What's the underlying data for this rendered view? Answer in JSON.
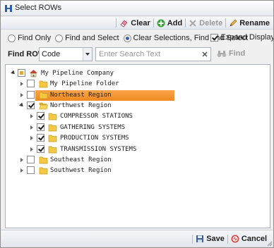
{
  "window": {
    "title": "Select ROWs"
  },
  "toolbar": {
    "clear_label": "Clear",
    "add_label": "Add",
    "delete_label": "Delete",
    "rename_label": "Rename"
  },
  "options": {
    "find_only": "Find Only",
    "find_and_select": "Find and Select",
    "clear_find_select": "Clear Selections, Find and Select",
    "selected_option": "clear_find_select",
    "expand_display": "Expand Display",
    "expand_display_checked": true
  },
  "find": {
    "label": "Find ROW",
    "field_value": "Code",
    "search_placeholder": "Enter Search Text",
    "find_label": "Find"
  },
  "tree": {
    "nodes": [
      {
        "label": "My Pipeline Company",
        "state": "partial",
        "expanded": true,
        "icon": "home-icon"
      },
      {
        "label": "My Pipeline Folder",
        "state": "unchecked",
        "expanded": false,
        "icon": "folder-icon"
      },
      {
        "label": "Northeast Region",
        "state": "unchecked",
        "expanded": false,
        "icon": "folder-icon",
        "highlighted": true
      },
      {
        "label": "Northwest Region",
        "state": "checked",
        "expanded": true,
        "icon": "folder-open-icon"
      },
      {
        "label": "COMPRESSOR STATIONS",
        "state": "checked",
        "expanded": false,
        "icon": "folder-icon"
      },
      {
        "label": "GATHERING SYSTEMS",
        "state": "checked",
        "expanded": false,
        "icon": "folder-icon"
      },
      {
        "label": "PRODUCTION SYSTEMS",
        "state": "checked",
        "expanded": false,
        "icon": "folder-icon"
      },
      {
        "label": "TRANSMISSION SYSTEMS",
        "state": "checked",
        "expanded": false,
        "icon": "folder-icon"
      },
      {
        "label": "Southeast Region",
        "state": "unchecked",
        "expanded": false,
        "icon": "folder-icon"
      },
      {
        "label": "Southwest Region",
        "state": "unchecked",
        "expanded": false,
        "icon": "folder-icon"
      }
    ]
  },
  "footer": {
    "save_label": "Save",
    "cancel_label": "Cancel"
  },
  "colors": {
    "highlight": "#f59a36",
    "folder": "#f5c842",
    "accent": "#3a63a8"
  }
}
